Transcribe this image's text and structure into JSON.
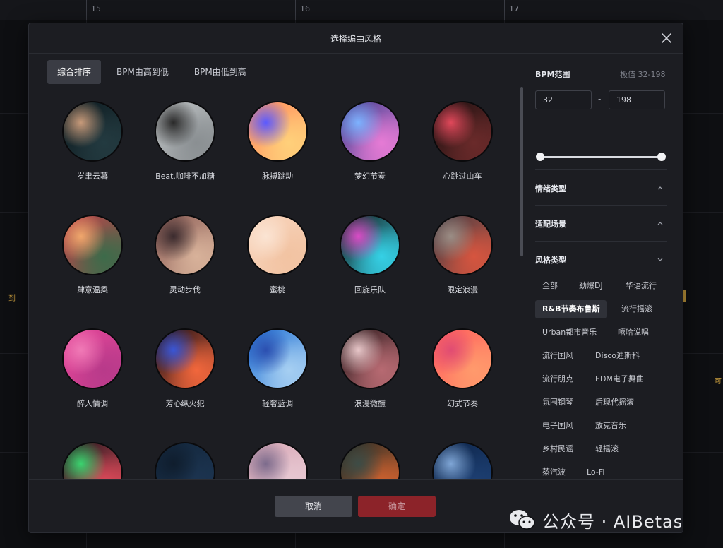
{
  "timeline": {
    "ticks": [
      "15",
      "16",
      "17"
    ],
    "left_tag": "到",
    "right_tag": "可"
  },
  "dialog": {
    "title": "选择编曲风格"
  },
  "sort_tabs": [
    {
      "label": "综合排序",
      "active": true
    },
    {
      "label": "BPM由高到低",
      "active": false
    },
    {
      "label": "BPM由低到高",
      "active": false
    }
  ],
  "styles": [
    {
      "name": "岁聿云暮",
      "colors": [
        "#0d1a1f",
        "#233a40",
        "#c79a7a"
      ]
    },
    {
      "name": "Beat.咖啡不加糖",
      "colors": [
        "#bfc3c5",
        "#8a8f92",
        "#2a2a2a"
      ]
    },
    {
      "name": "脉搏跳动",
      "colors": [
        "#ff8a5c",
        "#ffd07a",
        "#5b5aff"
      ]
    },
    {
      "name": "梦幻节奏",
      "colors": [
        "#3b3f8f",
        "#e67bd5",
        "#7db2ff"
      ]
    },
    {
      "name": "心跳过山车",
      "colors": [
        "#1c1010",
        "#6a2a2a",
        "#e0485a"
      ]
    },
    {
      "name": "肆意温柔",
      "colors": [
        "#c9414a",
        "#3c6b4a",
        "#f0a76c"
      ]
    },
    {
      "name": "灵动步伐",
      "colors": [
        "#8a5b55",
        "#d8b29a",
        "#3b2b2e"
      ]
    },
    {
      "name": "蜜桃",
      "colors": [
        "#f8d6bf",
        "#f2c3a2",
        "#fbe4d3"
      ]
    },
    {
      "name": "回旋乐队",
      "colors": [
        "#151515",
        "#35d1e6",
        "#d94cc6"
      ]
    },
    {
      "name": "限定浪漫",
      "colors": [
        "#3e3c44",
        "#d6553f",
        "#9a8d85"
      ]
    },
    {
      "name": "醉人情调",
      "colors": [
        "#e8489a",
        "#b83a8a",
        "#f07ab6"
      ]
    },
    {
      "name": "芳心纵火犯",
      "colors": [
        "#0e0a14",
        "#f2673c",
        "#3a56d6"
      ]
    },
    {
      "name": "轻奢蓝调",
      "colors": [
        "#1f6fd3",
        "#a6cff2",
        "#2b4fb0"
      ]
    },
    {
      "name": "浪漫微醺",
      "colors": [
        "#2b1a1c",
        "#b76a72",
        "#e8c7c9"
      ]
    },
    {
      "name": "幻式节奏",
      "colors": [
        "#ff5c5c",
        "#ff9a6c",
        "#e04c73"
      ]
    },
    {
      "name": "",
      "colors": [
        "#101418",
        "#e04a5a",
        "#3ad46f"
      ]
    },
    {
      "name": "",
      "colors": [
        "#13263b",
        "#1c3450",
        "#0f1d2d"
      ]
    },
    {
      "name": "",
      "colors": [
        "#d7a7b5",
        "#e8c9d3",
        "#7c6b8c"
      ]
    },
    {
      "name": "",
      "colors": [
        "#1e2a26",
        "#d0622f",
        "#3d4c46"
      ]
    },
    {
      "name": "",
      "colors": [
        "#0d2448",
        "#1d3f72",
        "#7fa6d6"
      ]
    }
  ],
  "filters": {
    "bpm": {
      "title": "BPM范围",
      "hint": "极值 32-198",
      "min": "32",
      "max": "198",
      "separator": "-",
      "range_min": 32,
      "range_max": 198,
      "value_min": 32,
      "value_max": 198
    },
    "sections": [
      {
        "title": "情绪类型",
        "expanded": false
      },
      {
        "title": "适配场景",
        "expanded": false
      },
      {
        "title": "风格类型",
        "expanded": true
      }
    ],
    "style_tags": [
      {
        "label": "全部",
        "active": false
      },
      {
        "label": "劲爆DJ",
        "active": false
      },
      {
        "label": "华语流行",
        "active": false
      },
      {
        "label": "R&B节奏布鲁斯",
        "active": true
      },
      {
        "label": "流行摇滚",
        "active": false
      },
      {
        "label": "Urban都市音乐",
        "active": false
      },
      {
        "label": "嘻哈说唱",
        "active": false
      },
      {
        "label": "流行国风",
        "active": false
      },
      {
        "label": "Disco迪斯科",
        "active": false
      },
      {
        "label": "流行朋克",
        "active": false
      },
      {
        "label": "EDM电子舞曲",
        "active": false
      },
      {
        "label": "氛围钢琴",
        "active": false
      },
      {
        "label": "后现代摇滚",
        "active": false
      },
      {
        "label": "电子国风",
        "active": false
      },
      {
        "label": "放克音乐",
        "active": false
      },
      {
        "label": "乡村民谣",
        "active": false
      },
      {
        "label": "轻摇滚",
        "active": false
      },
      {
        "label": "蒸汽波",
        "active": false
      },
      {
        "label": "Lo-Fi",
        "active": false
      }
    ]
  },
  "footer": {
    "cancel": "取消",
    "confirm": "确定"
  },
  "watermark": {
    "text": "公众号 · AIBetas",
    "icon": "wechat-icon"
  }
}
